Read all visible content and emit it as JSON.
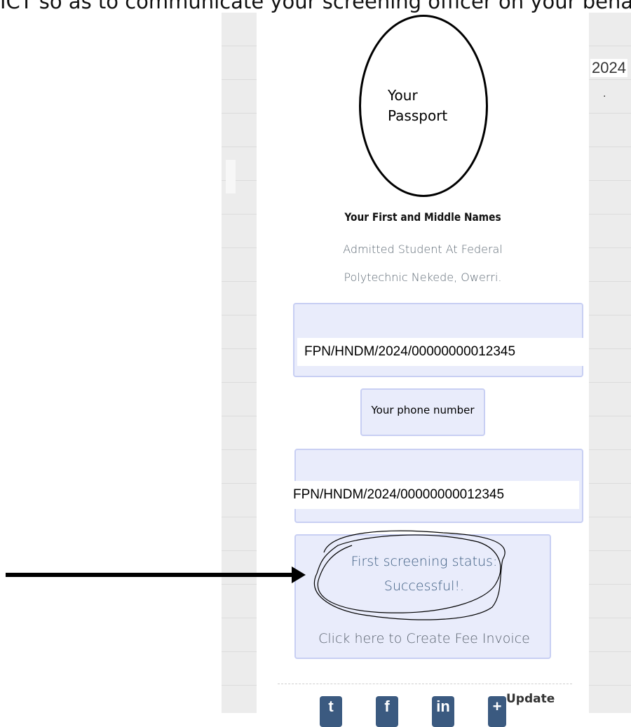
{
  "header": {
    "cut_off_text": "ICT so as to communicate your screening officer on your behalf",
    "right_fragment": "2024",
    "right_dot": "."
  },
  "profile": {
    "passport_label": "Your Passport",
    "name": "Your First and Middle Names",
    "description_line1": "Admitted Student At Federal",
    "description_line2": "Polytechnic Nekede, Owerri."
  },
  "fields": {
    "registration_number": "FPN/HNDM/2024/00000000012345",
    "phone_number": "Your phone number",
    "registration_number_repeat": "FPN/HNDM/2024/00000000012345"
  },
  "status": {
    "line1": "First screening status:",
    "line2": "Successful!.",
    "invoice_link": "Click here to Create Fee Invoice"
  },
  "footer": {
    "icons": [
      "twitter-icon",
      "facebook-icon",
      "linkedin-icon",
      "update-icon"
    ],
    "twitter_glyph": "t",
    "facebook_glyph": "f",
    "linkedin_glyph": "in",
    "update_glyph": "+",
    "update_label": "Update"
  },
  "colors": {
    "box_fill": "#e9ecfb",
    "box_border": "#c8cff3",
    "status_text": "#3c5c80",
    "social_blue": "#3b5a80"
  }
}
